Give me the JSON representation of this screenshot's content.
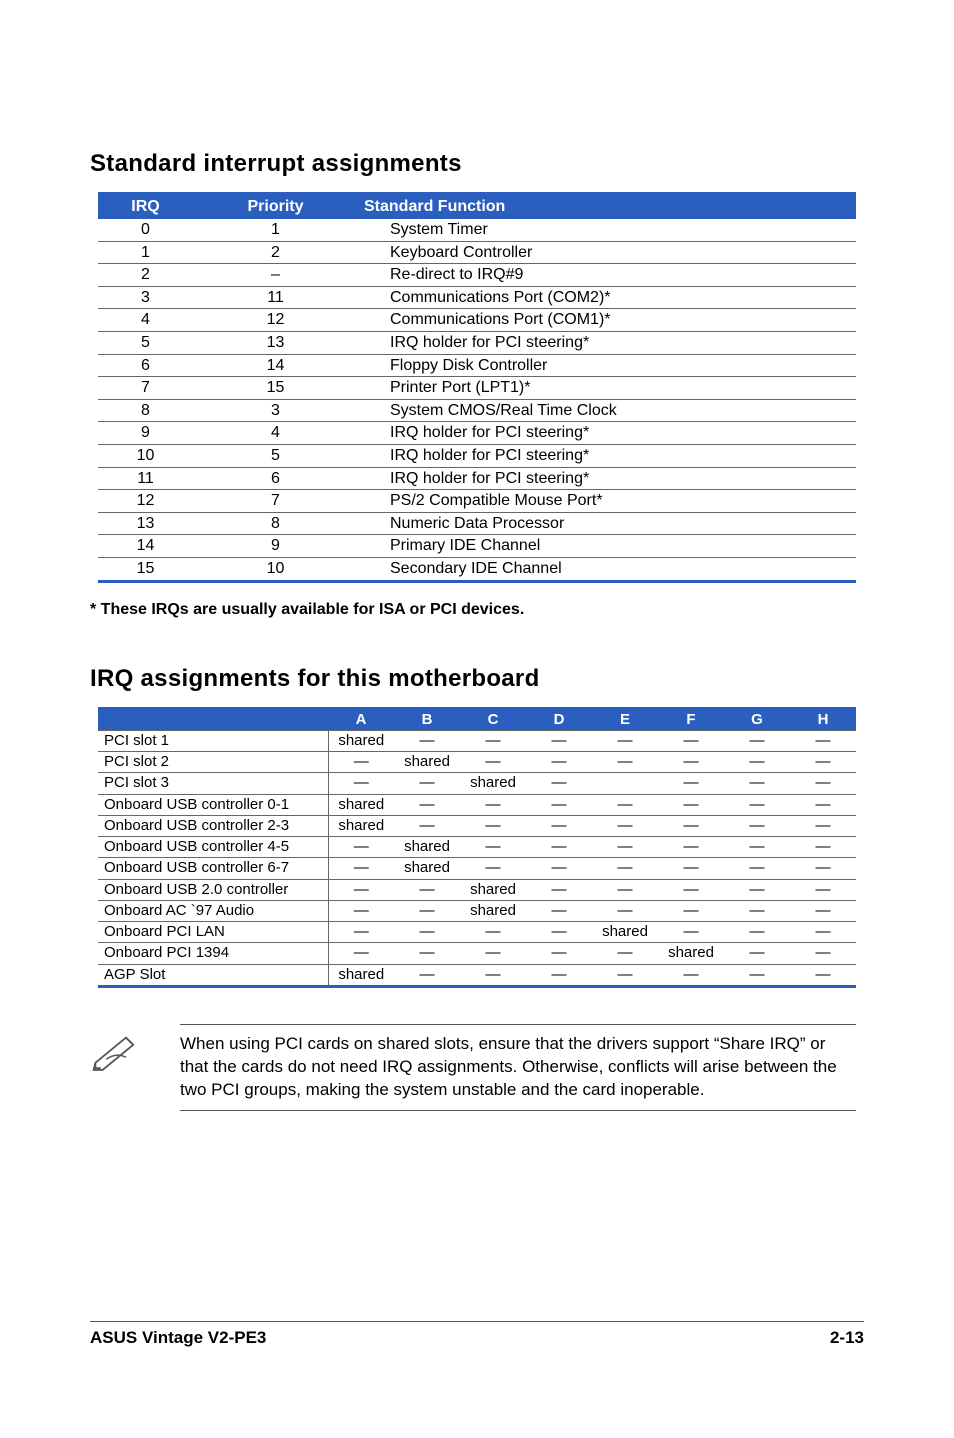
{
  "heading1": "Standard interrupt assignments",
  "table1": {
    "headers": {
      "irq": "IRQ",
      "priority": "Priority",
      "func": "Standard Function"
    },
    "rows": [
      {
        "irq": "0",
        "pri": "1",
        "func": "System Timer"
      },
      {
        "irq": "1",
        "pri": "2",
        "func": "Keyboard Controller"
      },
      {
        "irq": "2",
        "pri": "–",
        "func": "Re-direct to IRQ#9"
      },
      {
        "irq": "3",
        "pri": "11",
        "func": "Communications Port (COM2)*"
      },
      {
        "irq": "4",
        "pri": "12",
        "func": "Communications Port (COM1)*"
      },
      {
        "irq": "5",
        "pri": "13",
        "func": "IRQ holder for PCI steering*"
      },
      {
        "irq": "6",
        "pri": "14",
        "func": "Floppy Disk Controller"
      },
      {
        "irq": "7",
        "pri": "15",
        "func": "Printer Port (LPT1)*"
      },
      {
        "irq": "8",
        "pri": "3",
        "func": "System CMOS/Real Time Clock"
      },
      {
        "irq": "9",
        "pri": "4",
        "func": "IRQ holder for PCI steering*"
      },
      {
        "irq": "10",
        "pri": "5",
        "func": "IRQ holder for PCI steering*"
      },
      {
        "irq": "11",
        "pri": "6",
        "func": "IRQ holder for PCI steering*"
      },
      {
        "irq": "12",
        "pri": "7",
        "func": "PS/2 Compatible Mouse Port*"
      },
      {
        "irq": "13",
        "pri": "8",
        "func": "Numeric Data Processor"
      },
      {
        "irq": "14",
        "pri": "9",
        "func": "Primary IDE Channel"
      },
      {
        "irq": "15",
        "pri": "10",
        "func": "Secondary IDE Channel"
      }
    ]
  },
  "irq_note": "* These IRQs are usually available for ISA or PCI devices.",
  "heading2": "IRQ assignments for this motherboard",
  "table2": {
    "cols": [
      "A",
      "B",
      "C",
      "D",
      "E",
      "F",
      "G",
      "H"
    ],
    "rows": [
      {
        "label": "PCI slot 1",
        "cells": [
          "shared",
          "—",
          "—",
          "—",
          "—",
          "—",
          "—",
          "—"
        ]
      },
      {
        "label": "PCI slot 2",
        "cells": [
          "—",
          "shared",
          "—",
          "—",
          "—",
          "—",
          "—",
          "—"
        ]
      },
      {
        "label": "PCI slot 3",
        "cells": [
          "—",
          "—",
          "shared",
          "—",
          "",
          "—",
          "—",
          "—"
        ]
      },
      {
        "label": "Onboard USB controller 0-1",
        "cells": [
          "shared",
          "—",
          "—",
          "—",
          "—",
          "—",
          "—",
          "—"
        ]
      },
      {
        "label": "Onboard USB controller 2-3",
        "cells": [
          "shared",
          "—",
          "—",
          "—",
          "—",
          "—",
          "—",
          "—"
        ]
      },
      {
        "label": "Onboard USB controller 4-5",
        "cells": [
          "—",
          "shared",
          "—",
          "—",
          "—",
          "—",
          "—",
          "—"
        ]
      },
      {
        "label": "Onboard USB controller 6-7",
        "cells": [
          "—",
          "shared",
          "—",
          "—",
          "—",
          "—",
          "—",
          "—"
        ]
      },
      {
        "label": "Onboard USB 2.0 controller",
        "cells": [
          "—",
          "—",
          "shared",
          "—",
          "—",
          "—",
          "—",
          "—"
        ]
      },
      {
        "label": "Onboard AC `97 Audio",
        "cells": [
          "—",
          "—",
          "shared",
          "—",
          "—",
          "—",
          "—",
          "—"
        ]
      },
      {
        "label": "Onboard PCI LAN",
        "cells": [
          "—",
          "—",
          "—",
          "—",
          "shared",
          "—",
          "—",
          "—"
        ]
      },
      {
        "label": "Onboard PCI 1394",
        "cells": [
          "—",
          "—",
          "—",
          "—",
          "—",
          "shared",
          "—",
          "—"
        ]
      },
      {
        "label": "AGP Slot",
        "cells": [
          "shared",
          "—",
          "—",
          "—",
          "—",
          "—",
          "—",
          "—"
        ]
      }
    ]
  },
  "note_text": "When using PCI cards on shared slots, ensure that the drivers support “Share IRQ” or that the cards do not need IRQ assignments. Otherwise, conflicts will arise between the two PCI groups, making the system unstable and the card inoperable.",
  "footer": {
    "left": "ASUS Vintage V2-PE3",
    "right": "2-13"
  }
}
